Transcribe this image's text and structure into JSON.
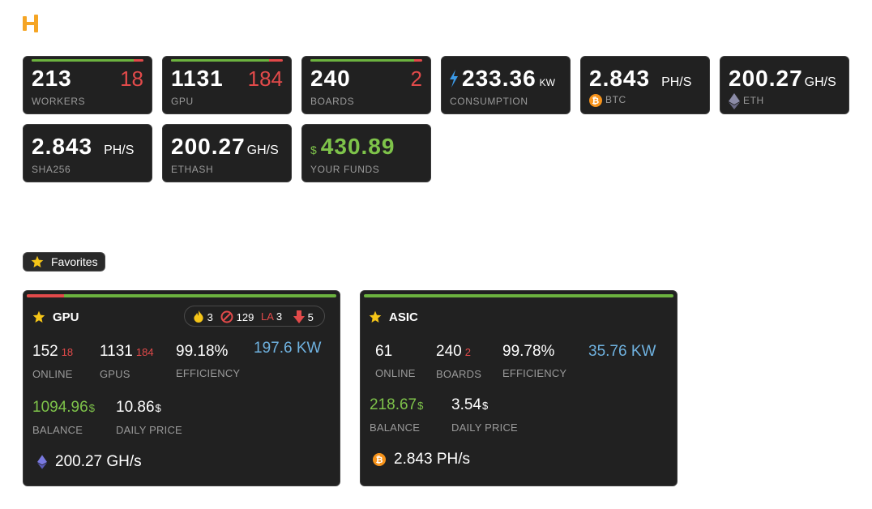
{
  "brand": {
    "logo_icon": "hive-logo-icon",
    "accent": "#f5a524"
  },
  "colors": {
    "card_bg": "#212121",
    "ok": "#6cb33f",
    "bad": "#e24a4a",
    "label": "#9a9a9a",
    "power": "#6fb2e0"
  },
  "stats": {
    "workers": {
      "value": "213",
      "offline": "18",
      "label": "WORKERS",
      "ok_fraction": 0.915
    },
    "gpu": {
      "value": "1131",
      "offline": "184",
      "label": "GPU",
      "ok_fraction": 0.88
    },
    "boards": {
      "value": "240",
      "offline": "2",
      "label": "BOARDS",
      "ok_fraction": 0.93
    },
    "consumption": {
      "value": "233.36",
      "unit": "KW",
      "label": "CONSUMPTION",
      "icon": "lightning-icon"
    },
    "btc": {
      "value": "2.843",
      "unit": "PH/S",
      "label": "BTC",
      "icon": "bitcoin-icon"
    },
    "eth": {
      "value": "200.27",
      "unit": "GH/S",
      "label": "ETH",
      "icon": "ethereum-icon"
    },
    "sha256": {
      "value": "2.843",
      "unit": "PH/S",
      "label": "SHA256"
    },
    "ethash": {
      "value": "200.27",
      "unit": "GH/S",
      "label": "ETHASH"
    },
    "funds": {
      "currency": "$",
      "value": "430.89",
      "label": "YOUR FUNDS"
    }
  },
  "favorites": {
    "label": "Favorites",
    "icon": "star-icon"
  },
  "gpu_card": {
    "title": "GPU",
    "health_bad_fraction": 0.12,
    "status": {
      "hot": "3",
      "blocked": "129",
      "la_label": "LA",
      "la": "3",
      "down": "5"
    },
    "online": "152",
    "online_off": "18",
    "online_label": "ONLINE",
    "gpus": "1131",
    "gpus_off": "184",
    "gpus_label": "GPUS",
    "efficiency": "99.18%",
    "efficiency_label": "EFFICIENCY",
    "power": "197.6 KW",
    "balance": "1094.96",
    "balance_label": "BALANCE",
    "daily_price": "10.86",
    "daily_price_label": "DAILY PRICE",
    "currency": "$",
    "hashrate": "200.27 GH/s",
    "hash_icon": "ethereum-icon"
  },
  "asic_card": {
    "title": "ASIC",
    "online": "61",
    "online_label": "ONLINE",
    "boards": "240",
    "boards_off": "2",
    "boards_label": "BOARDS",
    "efficiency": "99.78%",
    "efficiency_label": "EFFICIENCY",
    "power": "35.76 KW",
    "balance": "218.67",
    "balance_label": "BALANCE",
    "daily_price": "3.54",
    "daily_price_label": "DAILY PRICE",
    "currency": "$",
    "hashrate": "2.843 PH/s",
    "hash_icon": "bitcoin-icon"
  }
}
